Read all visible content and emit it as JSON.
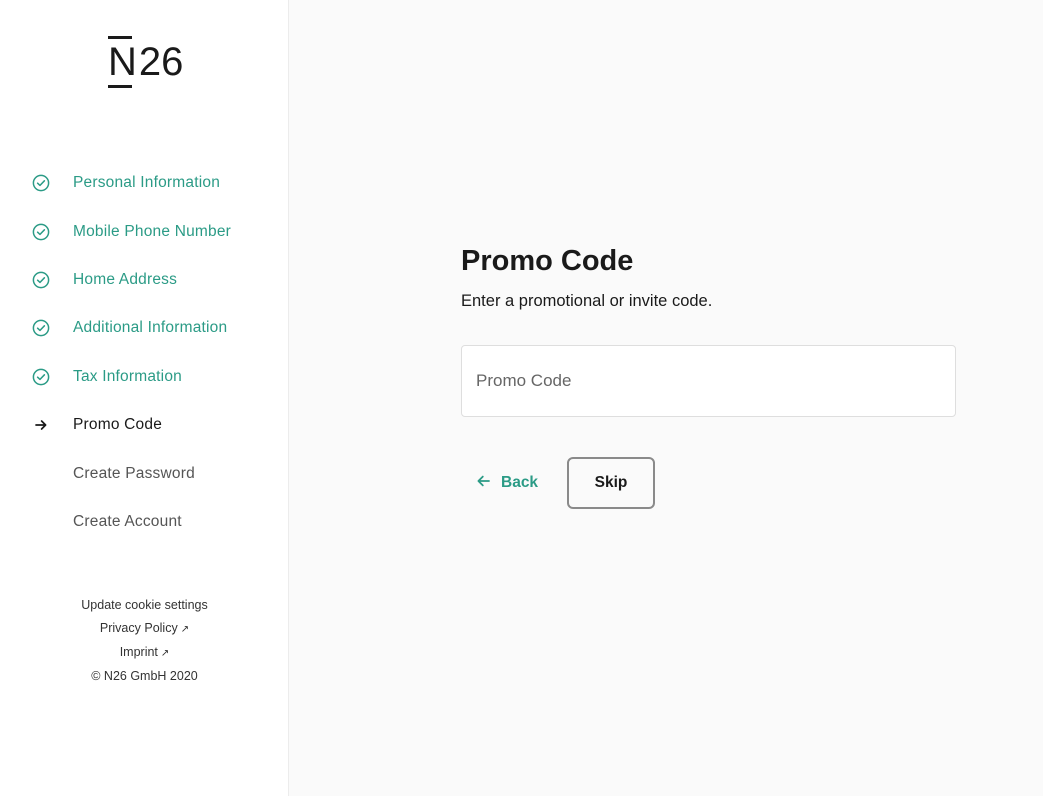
{
  "logo": {
    "text_n": "N",
    "text_rest": "26"
  },
  "steps": [
    {
      "label": "Personal Information",
      "state": "done"
    },
    {
      "label": "Mobile Phone Number",
      "state": "done"
    },
    {
      "label": "Home Address",
      "state": "done"
    },
    {
      "label": "Additional Information",
      "state": "done"
    },
    {
      "label": "Tax Information",
      "state": "done"
    },
    {
      "label": "Promo Code",
      "state": "current"
    },
    {
      "label": "Create Password",
      "state": "todo"
    },
    {
      "label": "Create Account",
      "state": "todo"
    }
  ],
  "footer": {
    "cookie": "Update cookie settings",
    "privacy": "Privacy Policy",
    "imprint": "Imprint",
    "copyright": "© N26 GmbH 2020"
  },
  "main": {
    "title": "Promo Code",
    "subtitle": "Enter a promotional or invite code.",
    "input_placeholder": "Promo Code",
    "input_value": "",
    "back_label": "Back",
    "skip_label": "Skip"
  },
  "colors": {
    "accent": "#2b9b86",
    "background": "#fafafa",
    "sidebar": "#ffffff"
  }
}
